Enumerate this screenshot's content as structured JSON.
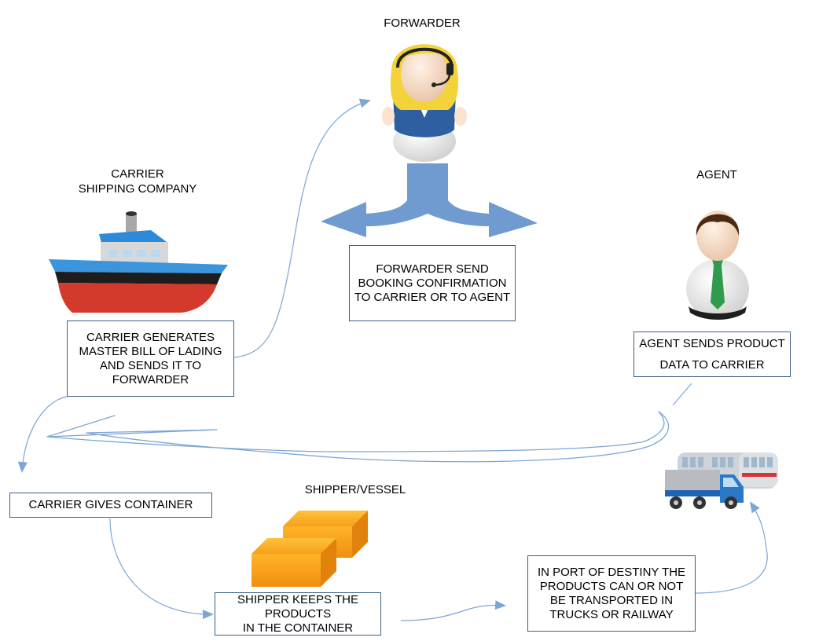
{
  "labels": {
    "forwarder": "FORWARDER",
    "carrier_line1": "CARRIER",
    "carrier_line2": "SHIPPING COMPANY",
    "agent": "AGENT",
    "shipper": "SHIPPER/VESSEL"
  },
  "boxes": {
    "forwarder_send": "FORWARDER SEND\nBOOKING CONFIRMATION\nTO CARRIER OR TO AGENT",
    "carrier_generates": "CARRIER GENERATES\nMASTER BILL OF LADING\nAND SENDS IT TO\nFORWARDER",
    "agent_sends": "AGENT SENDS PRODUCT\nDATA TO CARRIER",
    "carrier_gives": "CARRIER GIVES CONTAINER",
    "shipper_keeps": "SHIPPER KEEPS THE\nPRODUCTS\nIN THE CONTAINER",
    "port_destiny": "IN PORT OF DESTINY THE\nPRODUCTS CAN OR NOT\nBE TRANSPORTED IN\nTRUCKS OR RAILWAY"
  },
  "colors": {
    "connector": "#7ea6d3",
    "big_arrow": "#6f9bd0",
    "box_border": "#3a5f86",
    "container": "#f7a51c"
  },
  "icons": [
    "headset-person-icon",
    "ship-icon",
    "businessman-icon",
    "container-icon",
    "truck-train-icon"
  ]
}
